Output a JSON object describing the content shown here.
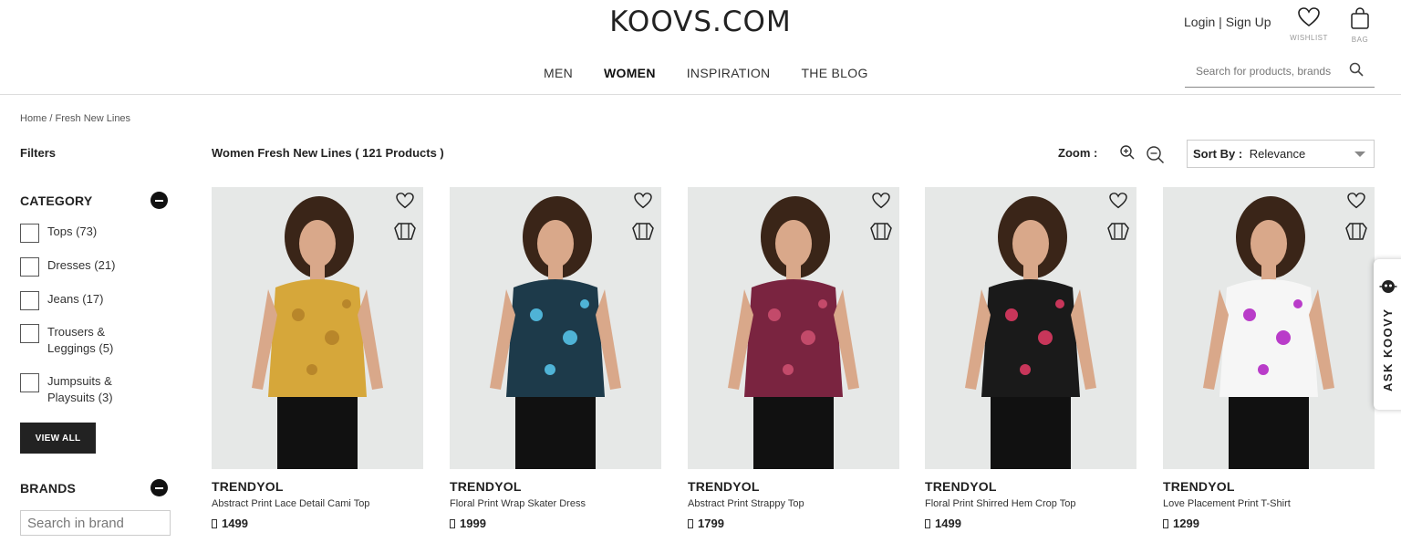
{
  "header": {
    "logo": "KOOVS.COM",
    "login_label": "Login",
    "separator": "|",
    "signup_label": "Sign Up",
    "wishlist_caption": "WISHLIST",
    "bag_caption": "BAG",
    "search_placeholder": "Search for products, brands",
    "nav": [
      {
        "label": "MEN",
        "active": false
      },
      {
        "label": "WOMEN",
        "active": true
      },
      {
        "label": "INSPIRATION",
        "active": false
      },
      {
        "label": "THE BLOG",
        "active": false
      }
    ]
  },
  "breadcrumb": {
    "home": "Home",
    "sep": " / ",
    "current": "Fresh New Lines"
  },
  "filters": {
    "title": "Filters",
    "category_title": "CATEGORY",
    "categories": [
      {
        "label": "Tops (73)"
      },
      {
        "label": "Dresses (21)"
      },
      {
        "label": "Jeans (17)"
      },
      {
        "label": "Trousers & Leggings (5)"
      },
      {
        "label": "Jumpsuits & Playsuits (3)"
      }
    ],
    "view_all_label": "VIEW ALL",
    "brands_title": "BRANDS",
    "brand_search_placeholder": "Search in brand"
  },
  "listing": {
    "title": "Women Fresh New Lines ( 121 Products )",
    "zoom_label": "Zoom :",
    "sort_label": "Sort By :",
    "sort_value": "Relevance"
  },
  "products": [
    {
      "brand": "TRENDYOL",
      "name": "Abstract Print Lace Detail Cami Top",
      "price": "1499",
      "color": "#d6a73a",
      "pattern": "#b8862a"
    },
    {
      "brand": "TRENDYOL",
      "name": "Floral Print Wrap Skater Dress",
      "price": "1999",
      "color": "#1d3a4a",
      "pattern": "#4fb3d6"
    },
    {
      "brand": "TRENDYOL",
      "name": "Abstract Print Strappy Top",
      "price": "1799",
      "color": "#7a2440",
      "pattern": "#c34a6a"
    },
    {
      "brand": "TRENDYOL",
      "name": "Floral Print Shirred Hem Crop Top",
      "price": "1499",
      "color": "#1a1a1a",
      "pattern": "#c8365a"
    },
    {
      "brand": "TRENDYOL",
      "name": "Love Placement Print T-Shirt",
      "price": "1299",
      "color": "#f6f6f6",
      "pattern": "#b93cc9"
    }
  ],
  "ask_koovy": {
    "label": "ASK KOOVY"
  },
  "colors": {
    "accent": "#222222",
    "image_bg": "#e6e8e7"
  }
}
